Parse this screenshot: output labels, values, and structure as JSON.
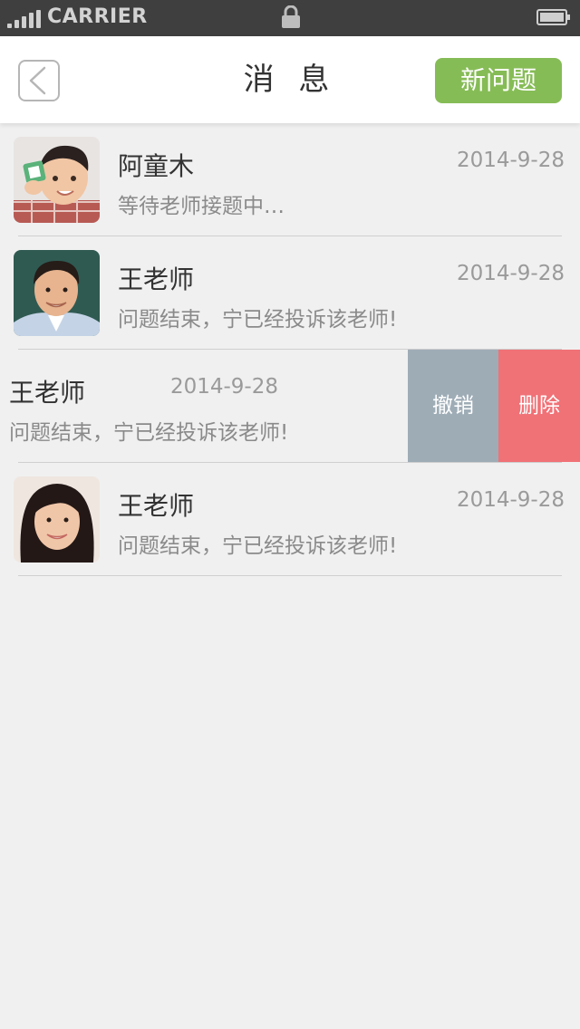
{
  "status_bar": {
    "carrier": "CARRIER",
    "signal_icon": "signal-bars-icon",
    "lock_icon": "lock-icon",
    "battery_icon": "battery-icon"
  },
  "header": {
    "title": "消 息",
    "back_icon": "chevron-left-icon",
    "new_question_label": "新问题"
  },
  "messages": [
    {
      "name": "阿童木",
      "date": "2014-9-28",
      "preview": "等待老师接题中…"
    },
    {
      "name": "王老师",
      "date": "2014-9-28",
      "preview": "问题结束，宁已经投诉该老师!"
    },
    {
      "name": "王老师",
      "date": "2014-9-28",
      "preview": "问题结束，宁已经投诉该老师!",
      "actions": {
        "undo_label": "撤销",
        "delete_label": "删除"
      }
    },
    {
      "name": "王老师",
      "date": "2014-9-28",
      "preview": "问题结束，宁已经投诉该老师!"
    }
  ],
  "colors": {
    "accent_green": "#86bc56",
    "undo_gray": "#9eacb6",
    "delete_red": "#f07176",
    "background": "#f0f0f0"
  }
}
